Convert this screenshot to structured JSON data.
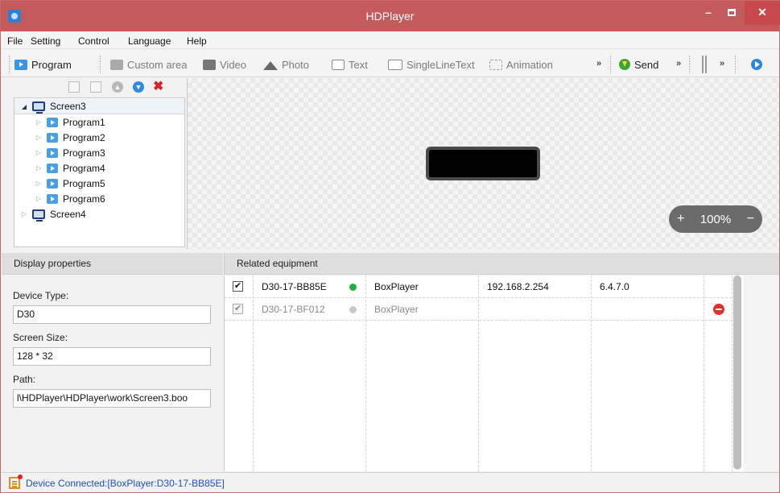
{
  "window": {
    "title": "HDPlayer",
    "minimize_glyph": "–",
    "close_glyph": "✕"
  },
  "menu": [
    "File",
    "Setting",
    "Control",
    "Language",
    "Help"
  ],
  "toolbar": {
    "program": "Program",
    "custom_area": "Custom area",
    "video": "Video",
    "photo": "Photo",
    "text": "Text",
    "single_line_text": "SingleLineText",
    "animation": "Animation",
    "more": "»",
    "send": "Send"
  },
  "tree_tools": {
    "delete_glyph": "✖",
    "up_glyph": "▲",
    "down_glyph": "▼"
  },
  "tree": {
    "screens": [
      {
        "name": "Screen3",
        "expanded": true,
        "programs": [
          "Program1",
          "Program2",
          "Program3",
          "Program4",
          "Program5",
          "Program6"
        ]
      },
      {
        "name": "Screen4",
        "expanded": false,
        "programs": []
      }
    ],
    "arrow_open": "◢",
    "arrow_closed": "▷"
  },
  "canvas": {
    "zoom_minus": "−",
    "zoom_plus": "+",
    "zoom_value": "100%"
  },
  "display_properties": {
    "header": "Display properties",
    "device_type_label": "Device Type:",
    "device_type_value": "D30",
    "screen_size_label": "Screen Size:",
    "screen_size_value": "128 * 32",
    "path_label": "Path:",
    "path_value": "l\\HDPlayer\\HDPlayer\\work\\Screen3.boo"
  },
  "related_equipment": {
    "header": "Related equipment",
    "check_glyph": "✔",
    "rows": [
      {
        "checked": true,
        "id": "D30-17-BB85E",
        "status_color": "#1cb33a",
        "type": "BoxPlayer",
        "ip": "192.168.2.254",
        "version": "6.4.7.0",
        "removable": false
      },
      {
        "checked": true,
        "id": "D30-17-BF012",
        "status_color": "#c8c8c8",
        "type": "BoxPlayer",
        "ip": "",
        "version": "",
        "removable": true
      }
    ]
  },
  "status_bar": {
    "text": "Device Connected:[BoxPlayer:D30-17-BB85E]"
  },
  "colors": {
    "titlebar": "#c35a5c",
    "status_text": "#1d4fc4",
    "online": "#1cb33a",
    "offline": "#c8c8c8",
    "delete": "#e0312b"
  }
}
